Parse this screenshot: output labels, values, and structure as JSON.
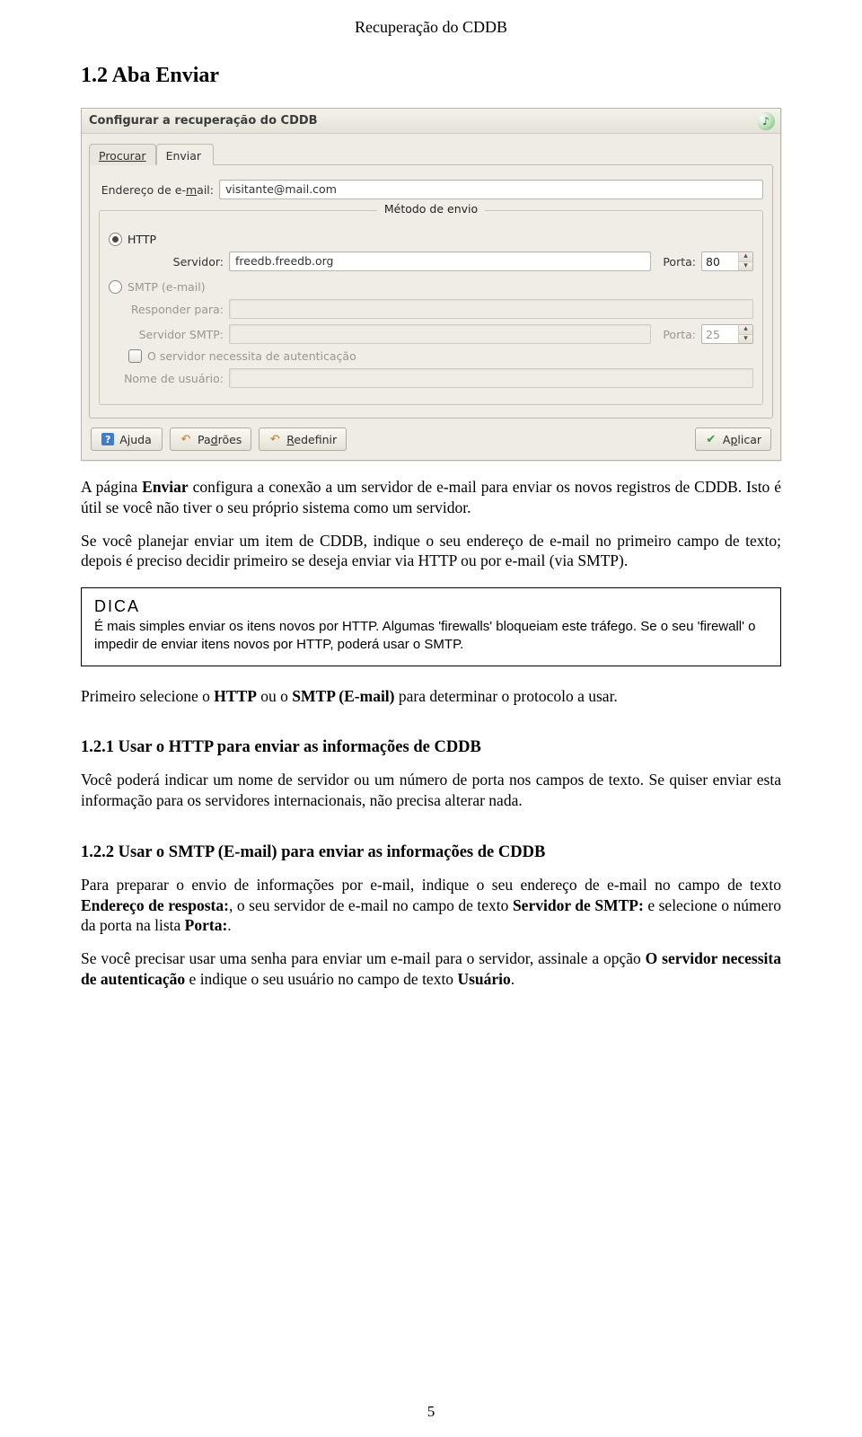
{
  "running_title": "Recuperação do CDDB",
  "section_heading": "1.2   Aba Enviar",
  "paragraphs": {
    "intro": "A página Enviar configura a conexão a um servidor de e-mail para enviar os novos registros de CDDB. Isto é útil se você não tiver o seu próprio sistema como um servidor.",
    "p2": "Se você planejar enviar um item de CDDB, indique o seu endereço de e-mail no primeiro campo de texto; depois é preciso decidir primeiro se deseja enviar via HTTP ou por e-mail (via SMTP).",
    "p3": "Primeiro selecione o HTTP ou o SMTP (E-mail) para determinar o protocolo a usar.",
    "p_http": "Você poderá indicar um nome de servidor ou um número de porta nos campos de texto. Se quiser enviar esta informação para os servidores internacionais, não precisa alterar nada.",
    "p_smtp1": "Para preparar o envio de informações por e-mail, indique o seu endereço de e-mail no campo de texto Endereço de resposta:, o seu servidor de e-mail no campo de texto Servidor de SMTP: e selecione o número da porta na lista Porta:.",
    "p_smtp2": "Se você precisar usar uma senha para enviar um e-mail para o servidor, assinale a opção O servidor necessita de autenticação e indique o seu usuário no campo de texto Usuário."
  },
  "tip": {
    "title": "DICA",
    "body": "É mais simples enviar os itens novos por HTTP. Algumas 'firewalls' bloqueiam este tráfego. Se o seu 'firewall' o impedir de enviar itens novos por HTTP, poderá usar o SMTP."
  },
  "subsections": {
    "http_heading": "1.2.1   Usar o HTTP para enviar as informações de CDDB",
    "smtp_heading": "1.2.2   Usar o SMTP (E-mail) para enviar as informações de CDDB"
  },
  "page_number": "5",
  "dialog": {
    "title": "Configurar a recuperação do CDDB",
    "tabs": {
      "lookup": "Procurar",
      "send": "Enviar"
    },
    "email_label_pre": "Endereço de e-",
    "email_label_ul": "m",
    "email_label_post": "ail:",
    "email_value": "visitante@mail.com",
    "method_group": "Método de envio",
    "http_label_ul": "H",
    "http_label_post": "TTP",
    "smtp_label_pre": "",
    "smtp_label_ul": "S",
    "smtp_label_post": "MTP (e-mail)",
    "server_label": "Servidor:",
    "http_server": "freedb.freedb.org",
    "port_label": "Porta:",
    "http_port": "80",
    "reply_label": "Responder para:",
    "reply_value": "",
    "smtp_server_label": "Servidor SMTP:",
    "smtp_server_value": "",
    "smtp_port": "25",
    "auth_label_pre": "",
    "auth_label_ul": "O",
    "auth_label_post": " servidor necessita de autenticação",
    "user_label": "Nome de usuário:",
    "user_value": "",
    "buttons": {
      "help_pre": "A",
      "help_ul": "j",
      "help_post": "uda",
      "defaults_pre": "Pa",
      "defaults_ul": "d",
      "defaults_post": "rões",
      "reset_pre": "",
      "reset_ul": "R",
      "reset_post": "edefinir",
      "apply_pre": "A",
      "apply_ul": "p",
      "apply_post": "licar"
    }
  }
}
